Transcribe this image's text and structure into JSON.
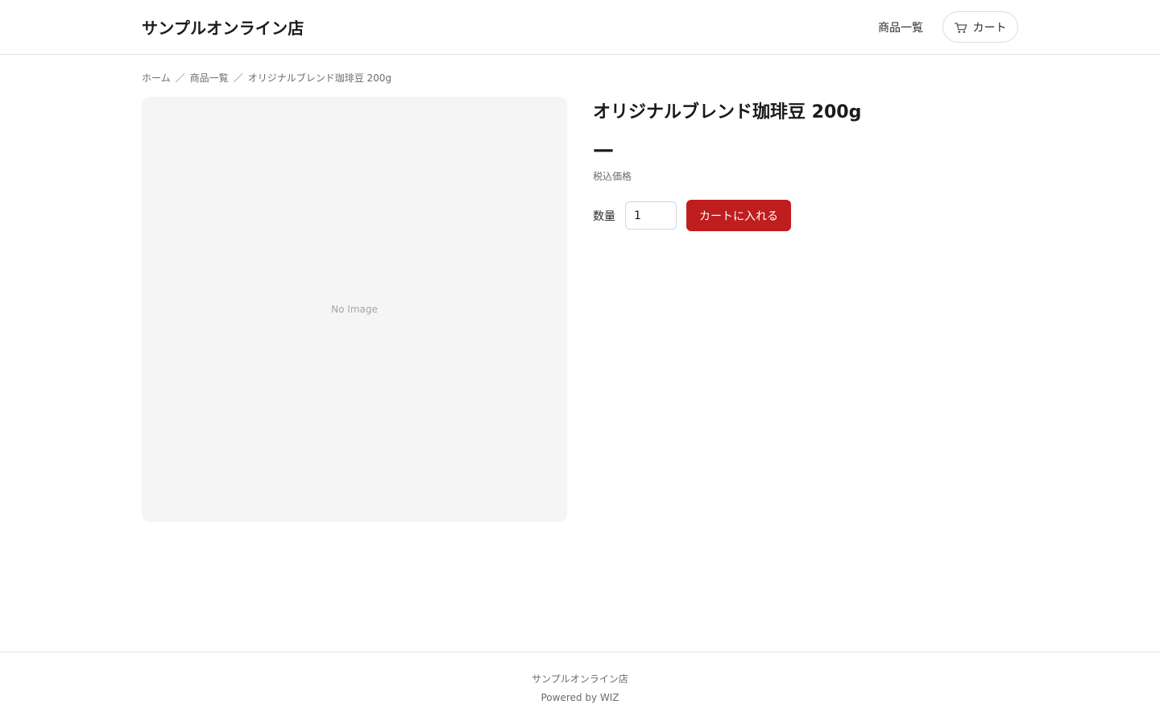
{
  "header": {
    "store_title": "サンプルオンライン店",
    "nav_products": "商品一覧",
    "cart_label": "カート",
    "cart_icon": "cart-icon"
  },
  "breadcrumb": {
    "items": [
      "ホーム",
      "商品一覧",
      "オリジナルブレンド珈琲豆 200g"
    ],
    "separator": "／"
  },
  "product": {
    "image_placeholder": "No Image",
    "name": "オリジナルブレンド珈琲豆 200g",
    "price": "—",
    "tax_label": "税込価格",
    "quantity_label": "数量",
    "quantity_value": "1",
    "add_to_cart_label": "カートに入れる"
  },
  "footer": {
    "store_name": "サンプルオンライン店",
    "powered_by": "Powered by WIZ"
  },
  "colors": {
    "accent": "#be1e1e",
    "text": "#1a1a1a",
    "muted": "#6b6b6b",
    "image_bg": "#f5f5f5",
    "border": "#e5e5e5"
  }
}
